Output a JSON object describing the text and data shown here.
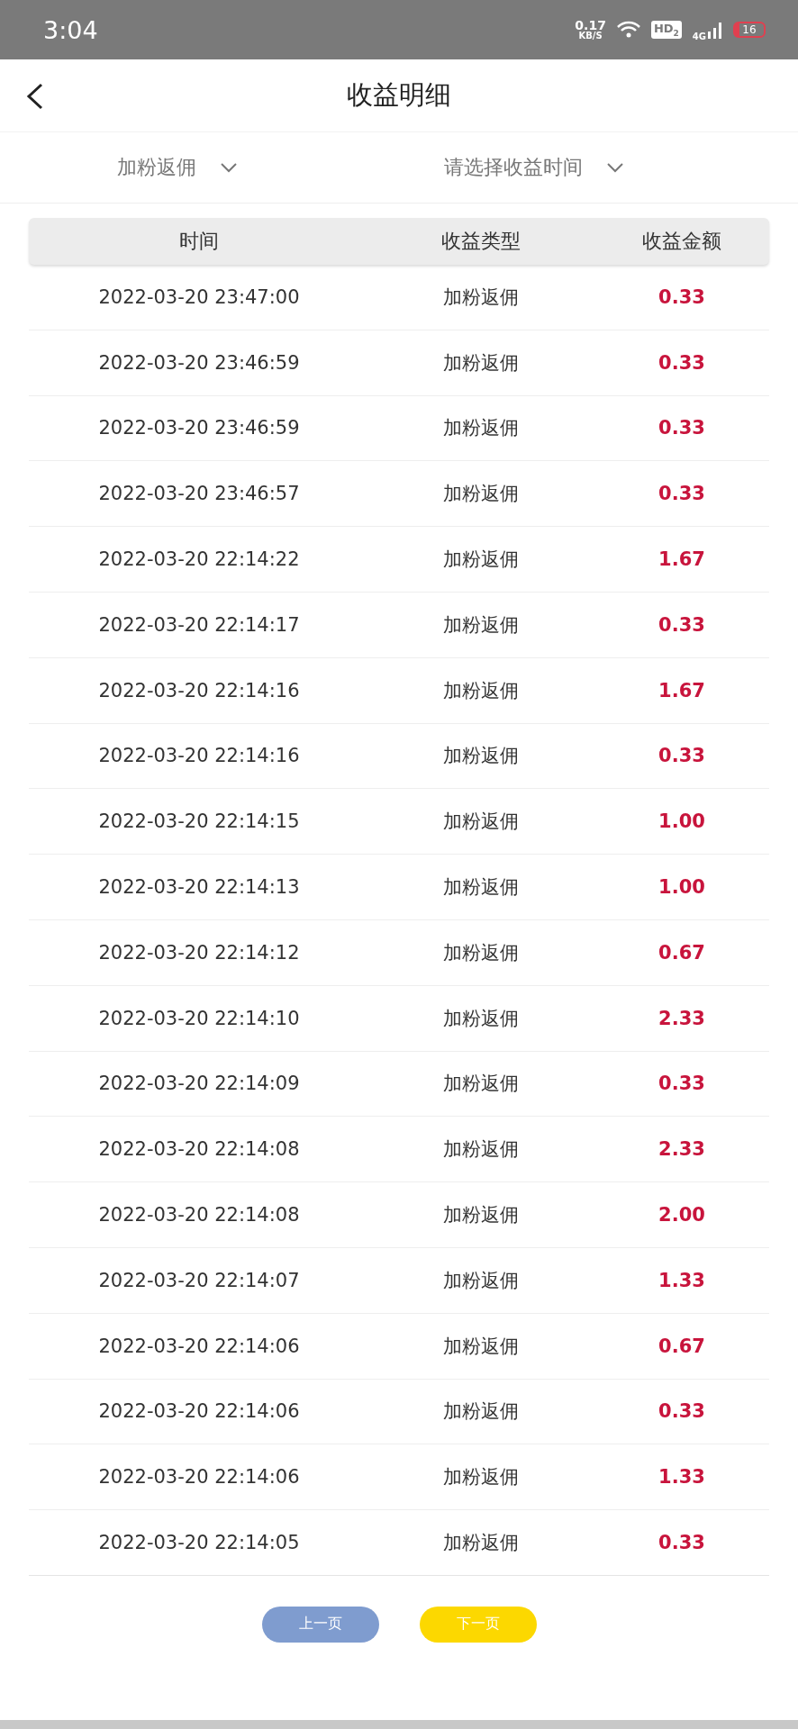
{
  "status_bar": {
    "time": "3:04",
    "speed": "0.17",
    "speed_unit": "KB/S",
    "hd": "HD$_{2}$",
    "network": "4G",
    "battery": "16"
  },
  "header": {
    "title": "收益明细"
  },
  "filters": [
    {
      "label": "加粉返佣"
    },
    {
      "label": "请选择收益时间"
    }
  ],
  "table": {
    "columns": [
      "时间",
      "收益类型",
      "收益金额"
    ],
    "rows": [
      {
        "time": "2022-03-20 23:47:00",
        "type": "加粉返佣",
        "amount": "0.33"
      },
      {
        "time": "2022-03-20 23:46:59",
        "type": "加粉返佣",
        "amount": "0.33"
      },
      {
        "time": "2022-03-20 23:46:59",
        "type": "加粉返佣",
        "amount": "0.33"
      },
      {
        "time": "2022-03-20 23:46:57",
        "type": "加粉返佣",
        "amount": "0.33"
      },
      {
        "time": "2022-03-20 22:14:22",
        "type": "加粉返佣",
        "amount": "1.67"
      },
      {
        "time": "2022-03-20 22:14:17",
        "type": "加粉返佣",
        "amount": "0.33"
      },
      {
        "time": "2022-03-20 22:14:16",
        "type": "加粉返佣",
        "amount": "1.67"
      },
      {
        "time": "2022-03-20 22:14:16",
        "type": "加粉返佣",
        "amount": "0.33"
      },
      {
        "time": "2022-03-20 22:14:15",
        "type": "加粉返佣",
        "amount": "1.00"
      },
      {
        "time": "2022-03-20 22:14:13",
        "type": "加粉返佣",
        "amount": "1.00"
      },
      {
        "time": "2022-03-20 22:14:12",
        "type": "加粉返佣",
        "amount": "0.67"
      },
      {
        "time": "2022-03-20 22:14:10",
        "type": "加粉返佣",
        "amount": "2.33"
      },
      {
        "time": "2022-03-20 22:14:09",
        "type": "加粉返佣",
        "amount": "0.33"
      },
      {
        "time": "2022-03-20 22:14:08",
        "type": "加粉返佣",
        "amount": "2.33"
      },
      {
        "time": "2022-03-20 22:14:08",
        "type": "加粉返佣",
        "amount": "2.00"
      },
      {
        "time": "2022-03-20 22:14:07",
        "type": "加粉返佣",
        "amount": "1.33"
      },
      {
        "time": "2022-03-20 22:14:06",
        "type": "加粉返佣",
        "amount": "0.67"
      },
      {
        "time": "2022-03-20 22:14:06",
        "type": "加粉返佣",
        "amount": "0.33"
      },
      {
        "time": "2022-03-20 22:14:06",
        "type": "加粉返佣",
        "amount": "1.33"
      },
      {
        "time": "2022-03-20 22:14:05",
        "type": "加粉返佣",
        "amount": "0.33"
      }
    ]
  },
  "pager": [
    {
      "label": "上一页",
      "disabled": true
    },
    {
      "label": "下一页",
      "disabled": false
    }
  ]
}
